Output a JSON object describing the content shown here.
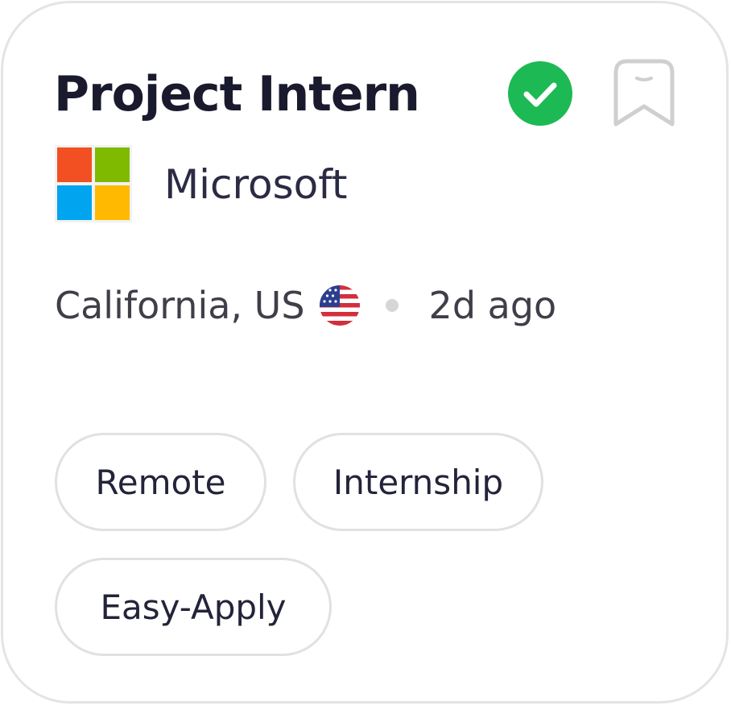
{
  "job": {
    "title": "Project Intern",
    "company": "Microsoft",
    "location": "California, US",
    "posted": "2d ago",
    "status_icon": "check-circle-icon",
    "bookmark_icon": "bookmark-icon",
    "logo_icon": "microsoft-logo-icon",
    "flag_icon": "us-flag-icon"
  },
  "tags": [
    {
      "label": "Remote"
    },
    {
      "label": "Internship"
    },
    {
      "label": "Easy-Apply"
    }
  ],
  "colors": {
    "verified": "#1db954",
    "bookmark": "#cfcfcf",
    "logo_red": "#f25022",
    "logo_green": "#7fba00",
    "logo_blue": "#00a4ef",
    "logo_yellow": "#ffb900"
  }
}
